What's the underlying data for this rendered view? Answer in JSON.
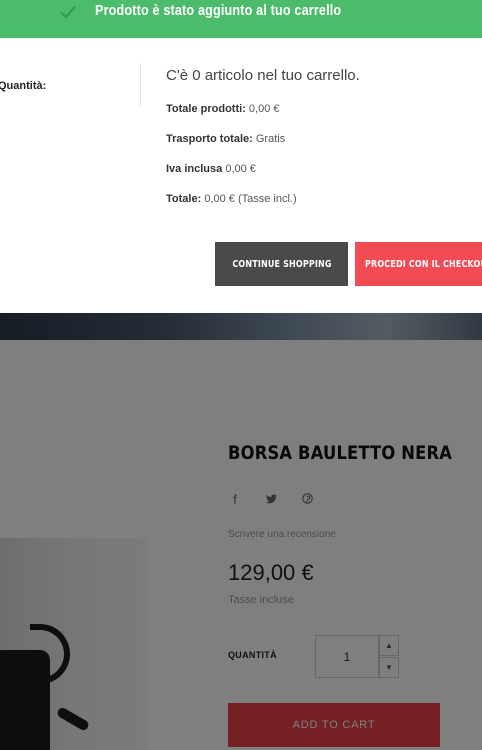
{
  "modal": {
    "header_title": "Prodotto è stato aggiunto al tuo carrello",
    "quantity_caption": "Quantità:",
    "cart_count_text": "C'è 0 articolo nel tuo carrello.",
    "summary": {
      "products_label": "Totale prodotti:",
      "products_value": "0,00 €",
      "shipping_label": "Trasporto totale:",
      "shipping_value": "Gratis",
      "tax_label": "Iva inclusa",
      "tax_value": "0,00 €",
      "total_label": "Totale:",
      "total_value": "0,00 € (Tasse incl.)"
    },
    "continue_label": "CONTINUE SHOPPING",
    "checkout_label": "PROCEDI CON IL CHECKOUT",
    "accent_color": "#4cbb6c"
  },
  "product": {
    "title": "BORSA BAULETTO NERA",
    "social_icons": [
      "facebook-icon",
      "twitter-icon",
      "pinterest-icon"
    ],
    "review_link": "Scrivere una recensione",
    "price": "129,00 €",
    "tax_note": "Tasse incluse",
    "quantity_label": "QUANTITÀ",
    "quantity_value": "1",
    "add_to_cart_label": "ADD TO CART",
    "accent_color": "#e84148"
  }
}
